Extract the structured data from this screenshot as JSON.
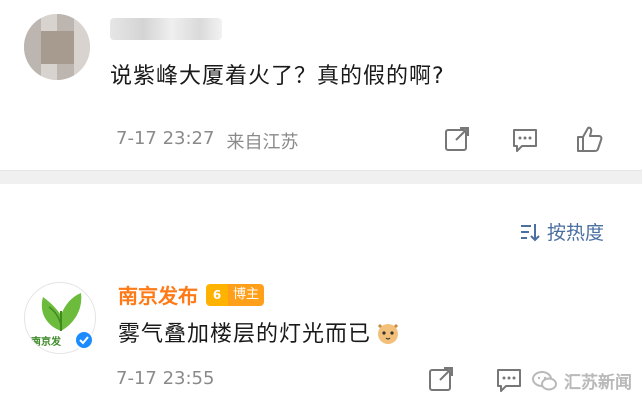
{
  "comments": [
    {
      "author": "",
      "text": "说紫峰大厦着火了？真的假的啊?",
      "date": "7-17 23:27",
      "source": "来自江苏",
      "actions": {
        "share": "share-icon",
        "comment": "comment-icon",
        "like": "thumbs-up-icon"
      }
    },
    {
      "author": "南京发布",
      "avatar_label": "南京发",
      "badge_level": "6",
      "badge": "博主",
      "text": "雾气叠加楼层的灯光而已",
      "date": "7-17 23:55",
      "actions": {
        "share": "share-icon",
        "comment": "comment-icon",
        "like": "thumbs-up-icon"
      }
    }
  ],
  "sort": {
    "label": "按热度",
    "icon": "sort-icon"
  },
  "watermark": {
    "text": "汇苏新闻",
    "icon": "wechat-icon"
  },
  "colors": {
    "author": "#ff7a16",
    "link": "#4a6fa0",
    "meta": "#8a8a8a",
    "verified": "#1a8cff"
  }
}
